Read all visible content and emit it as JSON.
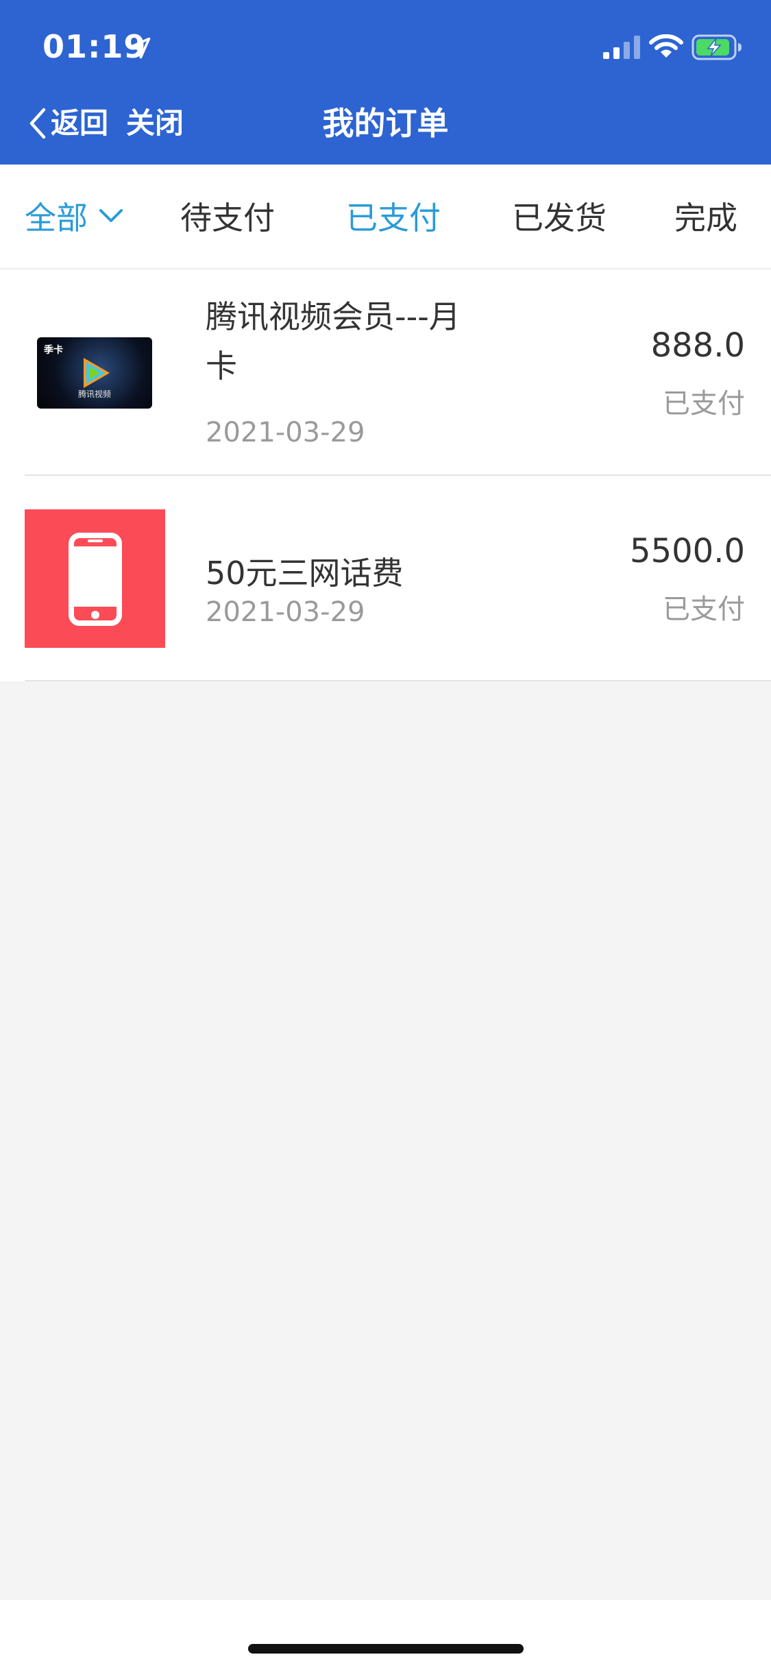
{
  "status_bar": {
    "time": "01:19",
    "location_icon": "location-arrow-icon",
    "signal_icon": "cellular-signal-icon",
    "wifi_icon": "wifi-icon",
    "battery_icon": "battery-charging-icon"
  },
  "nav": {
    "back_label": "返回",
    "close_label": "关闭",
    "title": "我的订单"
  },
  "tabs": [
    {
      "label": "全部",
      "active": true
    },
    {
      "label": "待支付",
      "active": false
    },
    {
      "label": "已支付",
      "active": true
    },
    {
      "label": "已发货",
      "active": false
    },
    {
      "label": "完成",
      "active": false
    }
  ],
  "orders": [
    {
      "name": "腾讯视频会员---月卡",
      "date": "2021-03-29",
      "price": "888.0",
      "status": "已支付",
      "thumb_tag": "季卡",
      "thumb_brand": "腾讯视频",
      "thumb_icon": "tencent-video-card-icon"
    },
    {
      "name": "50元三网话费",
      "date": "2021-03-29",
      "price": "5500.0",
      "status": "已支付",
      "thumb_icon": "mobile-phone-icon"
    }
  ],
  "colors": {
    "header_bg": "#2d64d2",
    "tab_active": "#2a9bd8",
    "phone_thumb_bg": "#fb4b57",
    "page_bg": "#f4f4f4"
  }
}
